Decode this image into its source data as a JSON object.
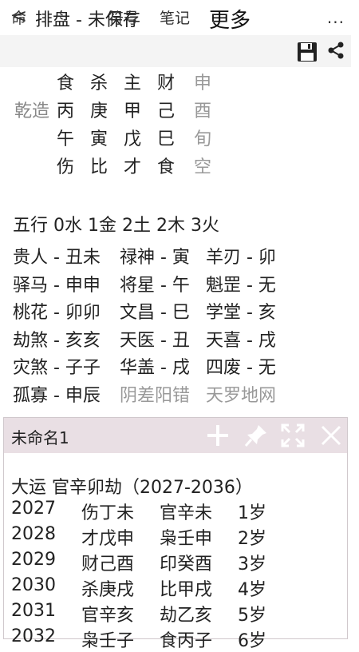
{
  "header": {
    "back": "<",
    "title": "排盘 - 未保存",
    "more": "..."
  },
  "tabs": {
    "ming": "命",
    "fuhao": "符号",
    "biji": "笔记",
    "gengduo": "更多"
  },
  "chart": {
    "label": "乾造",
    "rows": [
      [
        "食",
        "杀",
        "主",
        "财",
        "申"
      ],
      [
        "丙",
        "庚",
        "甲",
        "己",
        "酉"
      ],
      [
        "午",
        "寅",
        "戊",
        "巳",
        "旬"
      ],
      [
        "伤",
        "比",
        "才",
        "食",
        "空"
      ]
    ]
  },
  "wuxing": "五行 0水 1金 2土 2木  3火",
  "shensha": [
    {
      "a": "贵人 - 丑未",
      "b": "禄神 - 寅",
      "c": "羊刃 - 卯"
    },
    {
      "a": "驿马 - 申申",
      "b": "将星 - 午",
      "c": "魁罡 - 无"
    },
    {
      "a": "桃花 - 卯卯",
      "b": "文昌 - 巳",
      "c": "学堂 - 亥"
    },
    {
      "a": "劫煞 - 亥亥",
      "b": "天医 - 丑",
      "c": "天喜 - 戌"
    },
    {
      "a": "灾煞 - 子子",
      "b": "华盖 - 戌",
      "c": "四废 - 无"
    },
    {
      "a": "孤寡 - 申辰",
      "b": "阴差阳错",
      "c": "天罗地网"
    }
  ],
  "panel": {
    "title": "未命名1",
    "dayun": "大运 官辛卯劫（2027-2036）",
    "years": [
      {
        "year": "2027",
        "a": "伤丁未",
        "b": "官辛未",
        "age": "1岁"
      },
      {
        "year": "2028",
        "a": "才戊申",
        "b": "枭壬申",
        "age": "2岁"
      },
      {
        "year": "2029",
        "a": "财己酉",
        "b": "印癸酉",
        "age": "3岁"
      },
      {
        "year": "2030",
        "a": "杀庚戌",
        "b": "比甲戌",
        "age": "4岁"
      },
      {
        "year": "2031",
        "a": "官辛亥",
        "b": "劫乙亥",
        "age": "5岁"
      },
      {
        "year": "2032",
        "a": "枭壬子",
        "b": "食丙子",
        "age": "6岁"
      }
    ]
  }
}
